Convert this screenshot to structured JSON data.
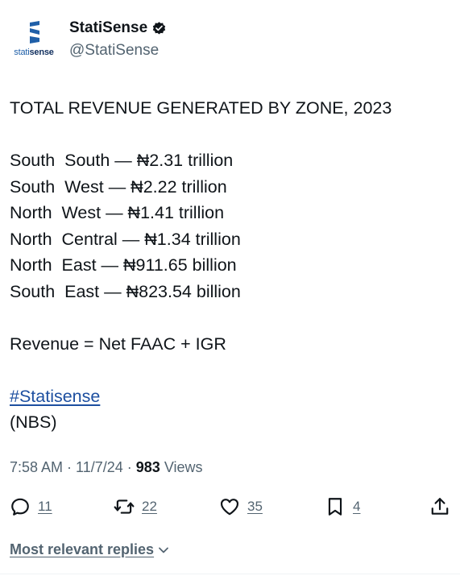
{
  "account": {
    "display_name": "StatiSense",
    "handle": "@StatiSense",
    "verified_icon": "verified-badge-icon",
    "avatar_brand_light": "stati",
    "avatar_brand_bold": "sense"
  },
  "post": {
    "title": "TOTAL REVENUE GENERATED BY ZONE, 2023",
    "zones": [
      "South  South — ₦2.31 trillion",
      "South  West — ₦2.22 trillion",
      "North  West — ₦1.41 trillion",
      "North  Central — ₦1.34 trillion",
      "North  East — ₦911.65 billion",
      "South  East — ₦823.54 billion"
    ],
    "formula": "Revenue = Net FAAC + IGR",
    "hashtag": "#Statisense",
    "source": "(NBS)"
  },
  "meta": {
    "time": "7:58 AM",
    "date": "11/7/24",
    "views_count": "983",
    "views_label": "Views"
  },
  "actions": {
    "reply_count": "11",
    "repost_count": "22",
    "like_count": "35",
    "bookmark_count": "4"
  },
  "replies": {
    "label": "Most relevant replies"
  },
  "colors": {
    "text": "#0f1419",
    "secondary": "#536471",
    "link": "#1d4fa0",
    "verified": "#0f1419",
    "brand_blue": "#1f5fa8"
  }
}
